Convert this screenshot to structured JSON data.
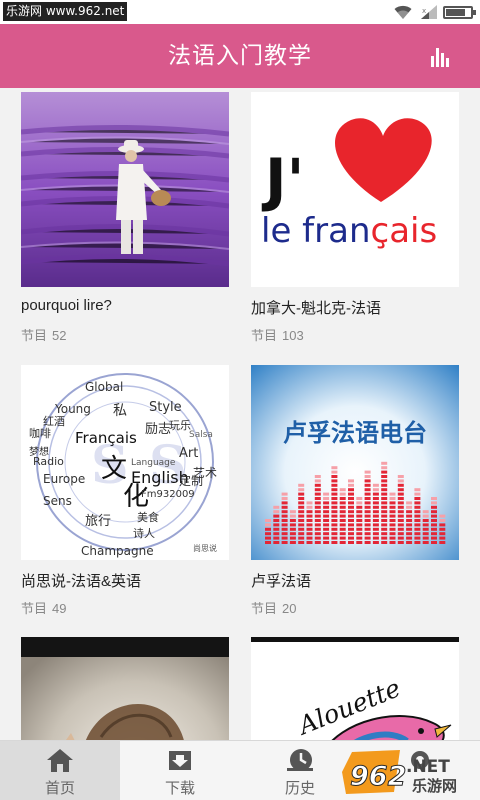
{
  "status": {
    "watermark": "乐游网 www.962.net",
    "battery_level": 0.85
  },
  "header": {
    "title": "法语入门教学",
    "chart_icon": "bar-chart-icon"
  },
  "programs": [
    {
      "name": "pourquoi lire?",
      "meta_label": "节目",
      "count": "52",
      "thumb_icon": "lavender-field-photo"
    },
    {
      "name": "加拿大-魁北克-法语",
      "meta_label": "节目",
      "count": "103",
      "thumb_icon": "j-heart-le-francais-logo",
      "thumb_text": {
        "j": "J'",
        "word": "le fran",
        "c": "ç",
        "tail": "ais"
      }
    },
    {
      "name": "尚思说-法语&英语",
      "meta_label": "节目",
      "count": "49",
      "thumb_icon": "word-cloud-seal",
      "thumb_words": [
        "Global",
        "Young",
        "Style",
        "Français",
        "Radio",
        "English",
        "Europe",
        "Sens",
        "Art",
        "Champagne",
        "文",
        "化",
        "Language",
        "Salsa",
        "艺术",
        "私",
        "励志",
        "玩乐",
        "旅行",
        "红酒",
        "咖啡",
        "梦想",
        "美食",
        "Fm932009",
        "诗人",
        "定制",
        "尚思说"
      ]
    },
    {
      "name": "卢孚法语",
      "meta_label": "节目",
      "count": "20",
      "thumb_icon": "radio-equalizer-banner",
      "thumb_text": "卢孚法语电台"
    },
    {
      "name": "",
      "meta_label": "",
      "count": "",
      "thumb_icon": "smoke-hair-portrait"
    },
    {
      "name": "",
      "meta_label": "",
      "count": "",
      "thumb_icon": "alouette-bird-drawing",
      "thumb_text": "Alouette"
    }
  ],
  "nav": [
    {
      "label": "首页",
      "icon": "home-icon",
      "active": true
    },
    {
      "label": "下载",
      "icon": "download-icon",
      "active": false
    },
    {
      "label": "历史",
      "icon": "history-icon",
      "active": false
    },
    {
      "label": "",
      "icon": "settings-icon",
      "active": false
    }
  ],
  "overlay_logo": {
    "digits": "962",
    "net": ".NET",
    "sub": "乐游网"
  },
  "colors": {
    "primary": "#d9598c",
    "background": "#f2f2f2",
    "nav_active": "#dcdcdc"
  }
}
